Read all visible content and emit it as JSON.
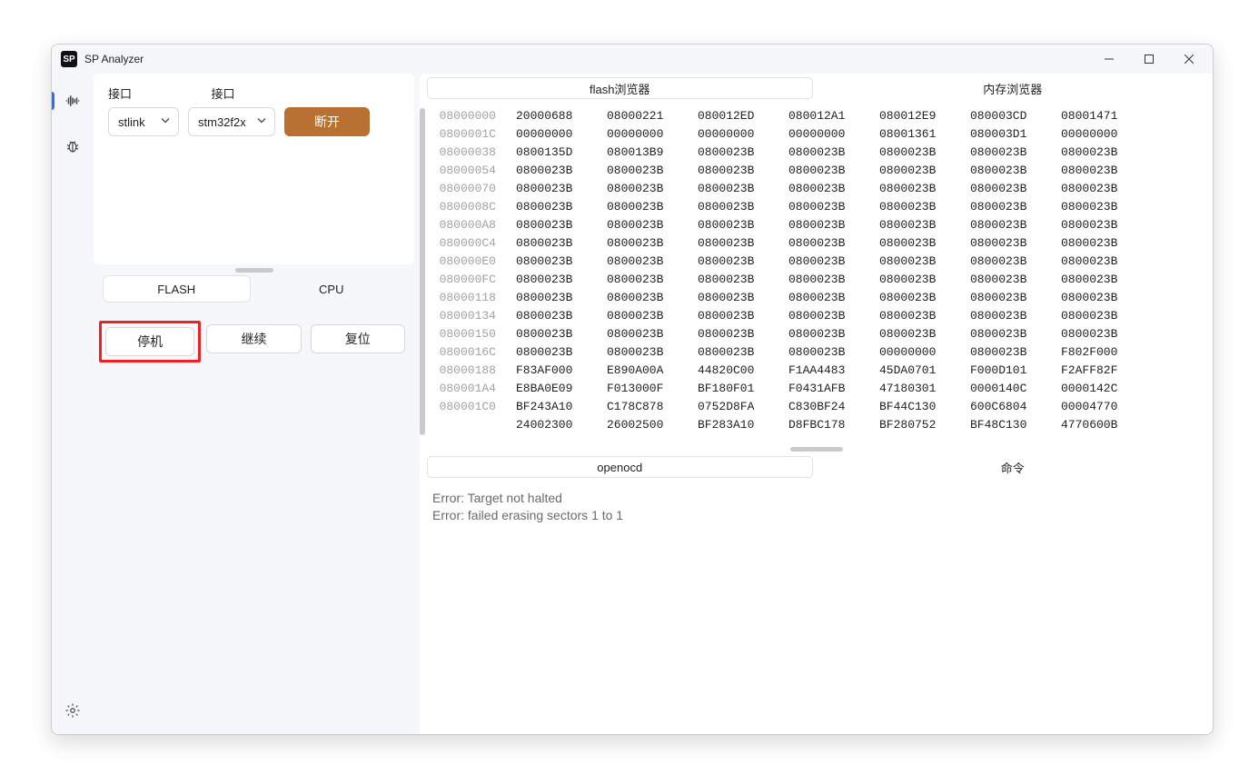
{
  "window": {
    "title": "SP Analyzer",
    "icon_text": "SP"
  },
  "sidebar": {
    "icons": [
      "signal-icon",
      "bug-icon",
      "gear-icon"
    ]
  },
  "connect": {
    "label1": "接口",
    "label2": "接口",
    "select1_value": "stlink",
    "select2_value": "stm32f2x",
    "disconnect_label": "断开"
  },
  "tabs": {
    "items": [
      {
        "label": "FLASH",
        "active": true
      },
      {
        "label": "CPU",
        "active": false
      }
    ]
  },
  "actions": {
    "halt": "停机",
    "continue": "继续",
    "reset": "复位"
  },
  "memory_tabs": {
    "items": [
      {
        "label": "flash浏览器",
        "active": true
      },
      {
        "label": "内存浏览器",
        "active": false
      }
    ]
  },
  "hex": {
    "rows": [
      {
        "addr": "08000000",
        "cells": [
          "20000688",
          "08000221",
          "080012ED",
          "080012A1",
          "080012E9",
          "080003CD",
          "08001471"
        ]
      },
      {
        "addr": "0800001C",
        "cells": [
          "00000000",
          "00000000",
          "00000000",
          "00000000",
          "08001361",
          "080003D1",
          "00000000"
        ]
      },
      {
        "addr": "08000038",
        "cells": [
          "0800135D",
          "080013B9",
          "0800023B",
          "0800023B",
          "0800023B",
          "0800023B",
          "0800023B"
        ]
      },
      {
        "addr": "08000054",
        "cells": [
          "0800023B",
          "0800023B",
          "0800023B",
          "0800023B",
          "0800023B",
          "0800023B",
          "0800023B"
        ]
      },
      {
        "addr": "08000070",
        "cells": [
          "0800023B",
          "0800023B",
          "0800023B",
          "0800023B",
          "0800023B",
          "0800023B",
          "0800023B"
        ]
      },
      {
        "addr": "0800008C",
        "cells": [
          "0800023B",
          "0800023B",
          "0800023B",
          "0800023B",
          "0800023B",
          "0800023B",
          "0800023B"
        ]
      },
      {
        "addr": "080000A8",
        "cells": [
          "0800023B",
          "0800023B",
          "0800023B",
          "0800023B",
          "0800023B",
          "0800023B",
          "0800023B"
        ]
      },
      {
        "addr": "080000C4",
        "cells": [
          "0800023B",
          "0800023B",
          "0800023B",
          "0800023B",
          "0800023B",
          "0800023B",
          "0800023B"
        ]
      },
      {
        "addr": "080000E0",
        "cells": [
          "0800023B",
          "0800023B",
          "0800023B",
          "0800023B",
          "0800023B",
          "0800023B",
          "0800023B"
        ]
      },
      {
        "addr": "080000FC",
        "cells": [
          "0800023B",
          "0800023B",
          "0800023B",
          "0800023B",
          "0800023B",
          "0800023B",
          "0800023B"
        ]
      },
      {
        "addr": "08000118",
        "cells": [
          "0800023B",
          "0800023B",
          "0800023B",
          "0800023B",
          "0800023B",
          "0800023B",
          "0800023B"
        ]
      },
      {
        "addr": "08000134",
        "cells": [
          "0800023B",
          "0800023B",
          "0800023B",
          "0800023B",
          "0800023B",
          "0800023B",
          "0800023B"
        ]
      },
      {
        "addr": "08000150",
        "cells": [
          "0800023B",
          "0800023B",
          "0800023B",
          "0800023B",
          "0800023B",
          "0800023B",
          "0800023B"
        ]
      },
      {
        "addr": "0800016C",
        "cells": [
          "0800023B",
          "0800023B",
          "0800023B",
          "0800023B",
          "00000000",
          "0800023B",
          "F802F000"
        ]
      },
      {
        "addr": "08000188",
        "cells": [
          "F83AF000",
          "E890A00A",
          "44820C00",
          "F1AA4483",
          "45DA0701",
          "F000D101",
          "F2AFF82F"
        ]
      },
      {
        "addr": "080001A4",
        "cells": [
          "E8BA0E09",
          "F013000F",
          "BF180F01",
          "F0431AFB",
          "47180301",
          "0000140C",
          "0000142C"
        ]
      },
      {
        "addr": "080001C0",
        "cells": [
          "BF243A10",
          "C178C878",
          "0752D8FA",
          "C830BF24",
          "BF44C130",
          "600C6804",
          "00004770"
        ]
      },
      {
        "addr": "",
        "cells": [
          "24002300",
          "26002500",
          "BF283A10",
          "D8FBC178",
          "BF280752",
          "BF48C130",
          "4770600B"
        ]
      }
    ]
  },
  "log_tabs": {
    "items": [
      {
        "label": "openocd",
        "active": true
      },
      {
        "label": "命令",
        "active": false
      }
    ]
  },
  "log": {
    "lines": [
      "Error: Target not halted",
      "Error: failed erasing sectors 1 to 1"
    ]
  }
}
